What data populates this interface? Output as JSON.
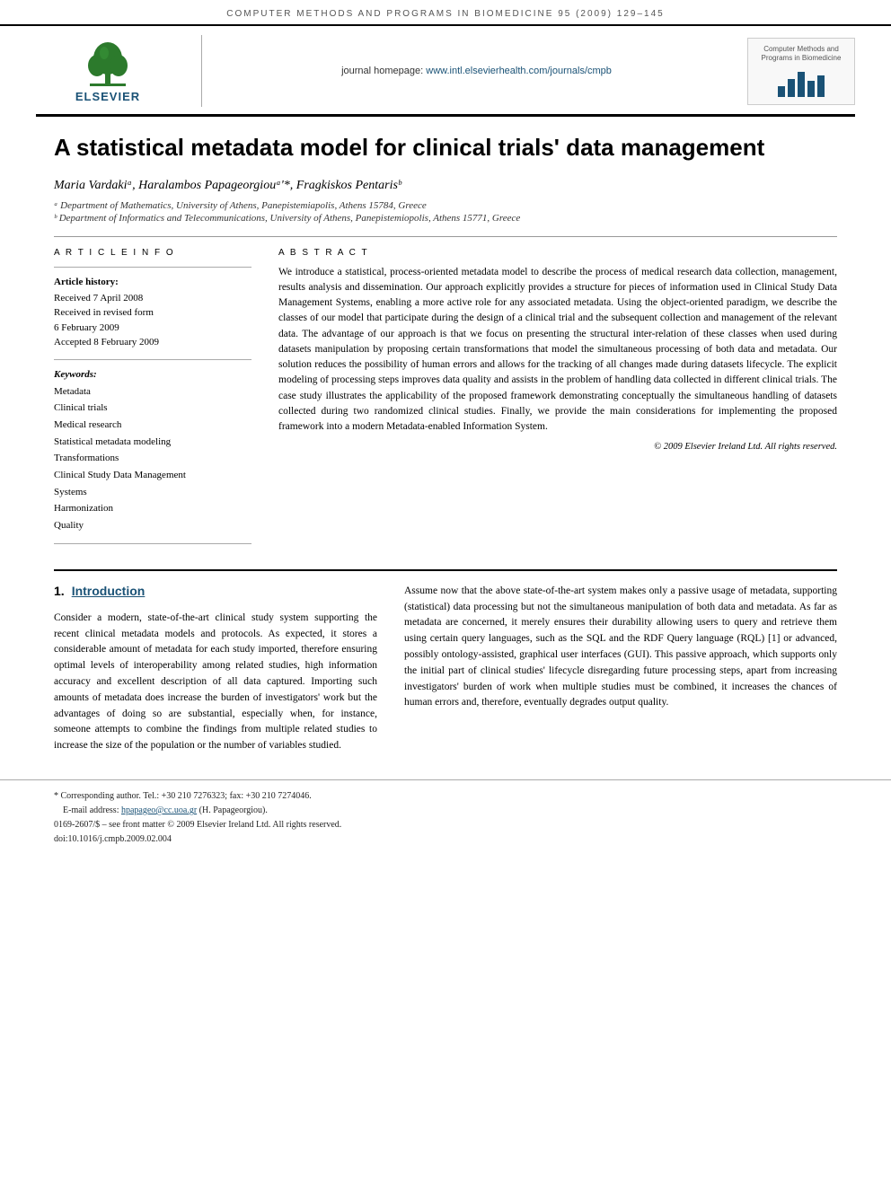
{
  "topbar": {
    "journal": "COMPUTER METHODS AND PROGRAMS IN BIOMEDICINE 95 (2009) 129–145"
  },
  "header": {
    "elsevier_label": "ELSEVIER",
    "journal_homepage_label": "journal homepage:",
    "journal_homepage_url": "www.intl.elsevierhealth.com/journals/cmpb",
    "right_logo_text": "Computer Methods and\nPrograms in Biomedicine"
  },
  "article": {
    "title": "A statistical metadata model for clinical trials' data management",
    "authors": "Maria Vardakiᵃ, Haralambos Papageorgiouᵃ'*, Fragkiskos Pentarisᵇ",
    "affiliation_a": "ᵃ Department of Mathematics, University of Athens, Panepistemiapolis, Athens 15784, Greece",
    "affiliation_b": "ᵇ Department of Informatics and Telecommunications, University of Athens, Panepistemiopolis, Athens 15771, Greece"
  },
  "article_info": {
    "col_header": "A R T I C L E   I N F O",
    "history_label": "Article history:",
    "received": "Received 7 April 2008",
    "revised": "Received in revised form\n6 February 2009",
    "accepted": "Accepted 8 February 2009",
    "keywords_label": "Keywords:",
    "keywords": [
      "Metadata",
      "Clinical trials",
      "Medical research",
      "Statistical metadata modeling",
      "Transformations",
      "Clinical Study Data Management Systems",
      "Harmonization",
      "Quality"
    ]
  },
  "abstract": {
    "col_header": "A B S T R A C T",
    "text": "We introduce a statistical, process-oriented metadata model to describe the process of medical research data collection, management, results analysis and dissemination. Our approach explicitly provides a structure for pieces of information used in Clinical Study Data Management Systems, enabling a more active role for any associated metadata. Using the object-oriented paradigm, we describe the classes of our model that participate during the design of a clinical trial and the subsequent collection and management of the relevant data. The advantage of our approach is that we focus on presenting the structural inter-relation of these classes when used during datasets manipulation by proposing certain transformations that model the simultaneous processing of both data and metadata. Our solution reduces the possibility of human errors and allows for the tracking of all changes made during datasets lifecycle. The explicit modeling of processing steps improves data quality and assists in the problem of handling data collected in different clinical trials. The case study illustrates the applicability of the proposed framework demonstrating conceptually the simultaneous handling of datasets collected during two randomized clinical studies. Finally, we provide the main considerations for implementing the proposed framework into a modern Metadata-enabled Information System.",
    "copyright": "© 2009 Elsevier Ireland Ltd. All rights reserved."
  },
  "section1": {
    "number": "1.",
    "title": "Introduction",
    "left_paragraphs": [
      "Consider a modern, state-of-the-art clinical study system supporting the recent clinical metadata models and protocols. As expected, it stores a considerable amount of metadata for each study imported, therefore ensuring optimal levels of interoperability among related studies, high information accuracy and excellent description of all data captured. Importing such amounts of metadata does increase the burden of investigators' work but the advantages of doing so are substantial, especially when, for instance, someone attempts to combine the findings from multiple related studies to increase the size of the population or the number of variables studied."
    ],
    "right_paragraphs": [
      "Assume now that the above state-of-the-art system makes only a passive usage of metadata, supporting (statistical) data processing but not the simultaneous manipulation of both data and metadata. As far as metadata are concerned, it merely ensures their durability allowing users to query and retrieve them using certain query languages, such as the SQL and the RDF Query language (RQL) [1] or advanced, possibly ontology-assisted, graphical user interfaces (GUI). This passive approach, which supports only the initial part of clinical studies' lifecycle disregarding future processing steps, apart from increasing investigators' burden of work when multiple studies must be combined, it increases the chances of human errors and, therefore, eventually degrades output quality."
    ]
  },
  "footnote": {
    "corresponding_author": "* Corresponding author. Tel.: +30 210 7276323; fax: +30 210 7274046.",
    "email_label": "E-mail address:",
    "email": "hpapageo@cc.uoa.gr",
    "email_name": "H. Papageorgiou",
    "issn_line": "0169-2607/$ – see front matter © 2009 Elsevier Ireland Ltd. All rights reserved.",
    "doi_line": "doi:10.1016/j.cmpb.2009.02.004"
  }
}
